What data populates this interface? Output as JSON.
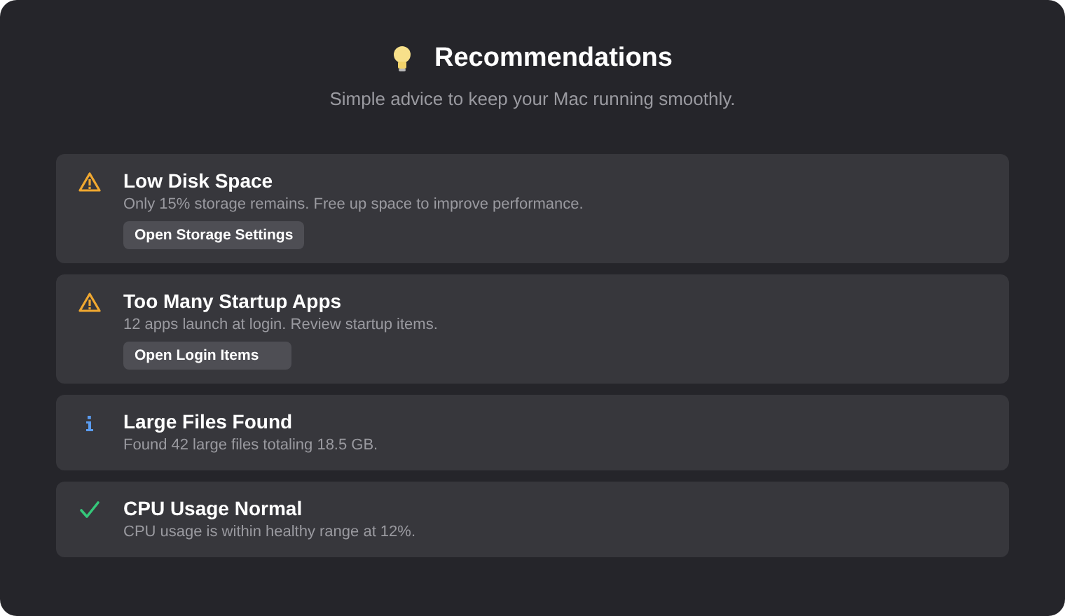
{
  "header": {
    "title": "Recommendations",
    "subtitle": "Simple advice to keep your Mac running smoothly."
  },
  "recommendations": [
    {
      "kind": "warning",
      "title": "Low Disk Space",
      "description": "Only 15% storage remains. Free up space to improve performance.",
      "action": "Open Storage Settings"
    },
    {
      "kind": "warning",
      "title": "Too Many Startup Apps",
      "description": "12 apps launch at login. Review startup items.",
      "action": "Open Login Items"
    },
    {
      "kind": "info",
      "title": "Large Files Found",
      "description": "Found 42 large files totaling 18.5 GB."
    },
    {
      "kind": "success",
      "title": "CPU Usage Normal",
      "description": "CPU usage is within healthy range at 12%."
    }
  ]
}
